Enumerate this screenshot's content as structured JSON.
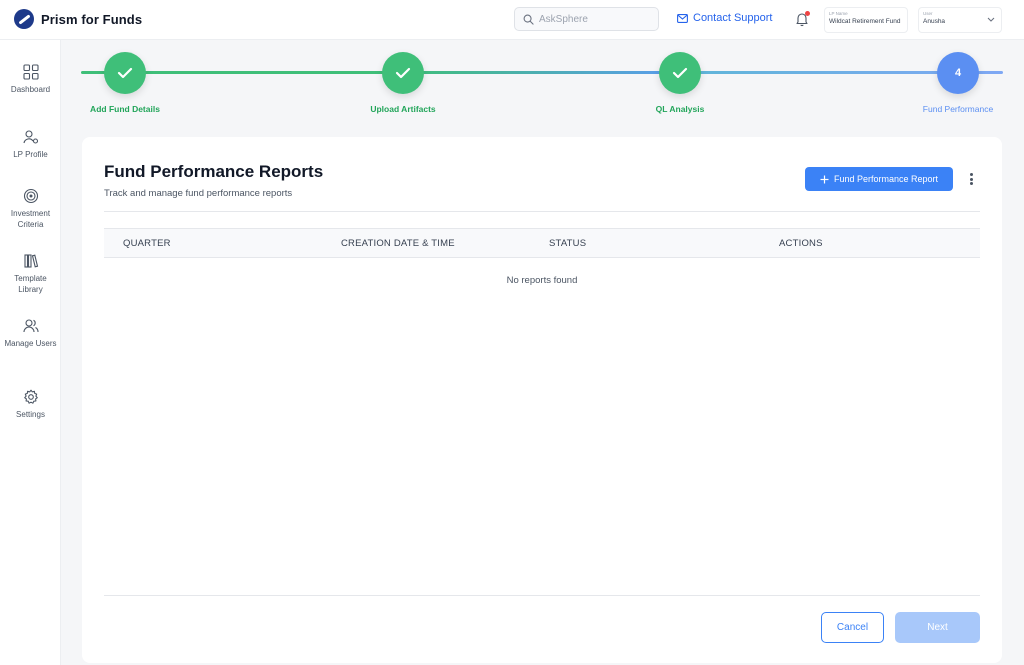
{
  "header": {
    "brand": "Prism for Funds",
    "search_placeholder": "AskSphere",
    "contact_support": "Contact Support",
    "lp_name_label": "LP Name",
    "lp_name_value": "Wildcat Retirement Fund",
    "user_label": "User",
    "user_value": "Anusha"
  },
  "sidebar": {
    "items": [
      {
        "label": "Dashboard",
        "icon": "grid-icon"
      },
      {
        "label": "LP Profile",
        "icon": "user-settings-icon"
      },
      {
        "label": "Investment Criteria",
        "icon": "target-icon"
      },
      {
        "label": "Template Library",
        "icon": "books-icon"
      },
      {
        "label": "Manage Users",
        "icon": "users-icon"
      },
      {
        "label": "Settings",
        "icon": "gear-icon"
      }
    ]
  },
  "stepper": {
    "steps": [
      {
        "label": "Add Fund Details",
        "state": "done"
      },
      {
        "label": "Upload Artifacts",
        "state": "done"
      },
      {
        "label": "QL Analysis",
        "state": "done"
      },
      {
        "label": "Fund Performance",
        "state": "active",
        "number": "4"
      }
    ]
  },
  "main": {
    "title": "Fund Performance Reports",
    "subtitle": "Track and manage fund performance reports",
    "add_button": "Fund Performance Report",
    "columns": [
      "QUARTER",
      "CREATION DATE & TIME",
      "STATUS",
      "ACTIONS"
    ],
    "empty_message": "No reports found",
    "cancel_label": "Cancel",
    "next_label": "Next"
  },
  "colors": {
    "accent": "#3b82f6",
    "success": "#3fbf79",
    "success_text": "#22a55a",
    "brand_dark": "#1e3a8a",
    "notification": "#ef4444"
  }
}
